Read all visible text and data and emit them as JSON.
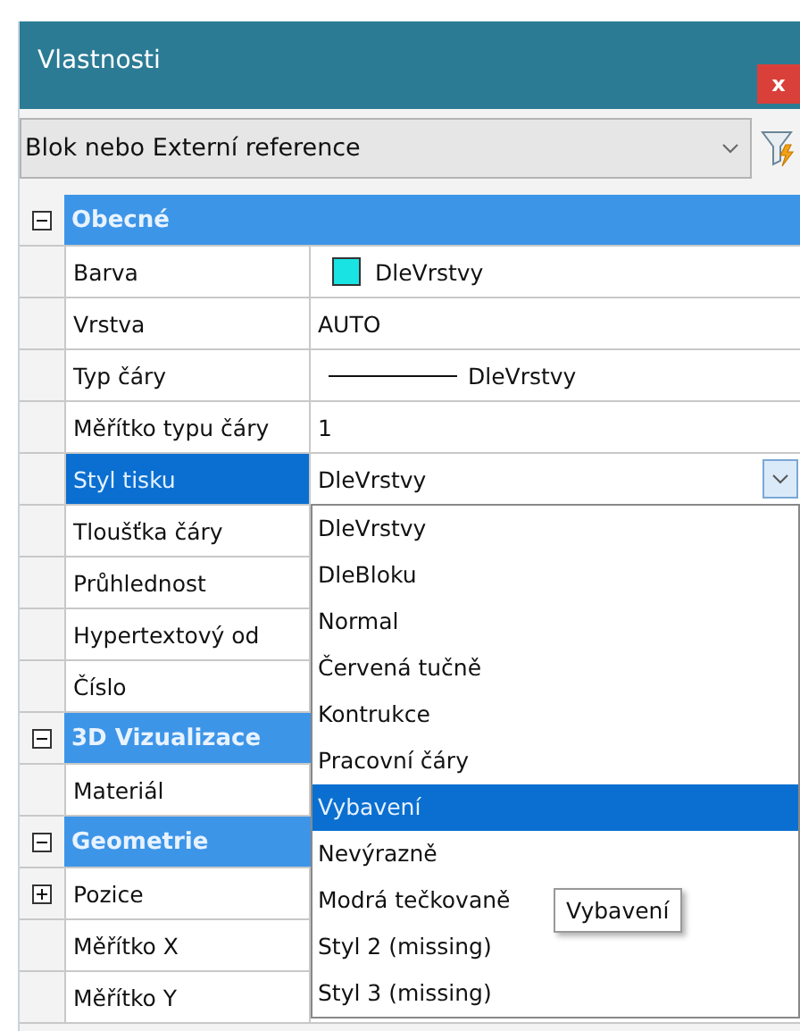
{
  "window": {
    "title": "Vlastnosti",
    "close": "x"
  },
  "selector": {
    "value": "Blok nebo Externí reference"
  },
  "sections": [
    {
      "title": "Obecné",
      "expanded": true,
      "properties": [
        {
          "name": "Barva",
          "value": "DleVrstvy",
          "kind": "color",
          "color": "#19e3e3",
          "selected": false
        },
        {
          "name": "Vrstva",
          "value": "AUTO",
          "kind": "text",
          "selected": false
        },
        {
          "name": "Typ čáry",
          "value": "DleVrstvy",
          "kind": "linetype",
          "selected": false
        },
        {
          "name": "Měřítko typu čáry",
          "value": "1",
          "kind": "text",
          "selected": false
        },
        {
          "name": "Styl tisku",
          "value": "DleVrstvy",
          "kind": "dropdown",
          "selected": true
        },
        {
          "name": "Tloušťka čáry",
          "kind": "text",
          "selected": false
        },
        {
          "name": "Průhlednost",
          "kind": "text",
          "selected": false
        },
        {
          "name": "Hypertextový od",
          "kind": "text",
          "selected": false
        },
        {
          "name": "Číslo",
          "kind": "text",
          "selected": false
        }
      ]
    },
    {
      "title": "3D Vizualizace",
      "expanded": true,
      "properties": [
        {
          "name": "Materiál",
          "kind": "text",
          "selected": false
        }
      ]
    },
    {
      "title": "Geometrie",
      "expanded": true,
      "properties": [
        {
          "name": "Pozice",
          "kind": "group",
          "expanded": false,
          "selected": false
        },
        {
          "name": "Měřítko X",
          "kind": "text",
          "selected": false
        },
        {
          "name": "Měřítko Y",
          "kind": "text",
          "selected": false
        }
      ]
    }
  ],
  "dropdown": {
    "items": [
      {
        "label": "DleVrstvy",
        "selected": false
      },
      {
        "label": "DleBloku",
        "selected": false
      },
      {
        "label": "Normal",
        "selected": false
      },
      {
        "label": "Červená tučně",
        "selected": false
      },
      {
        "label": "Kontrukce",
        "selected": false
      },
      {
        "label": "Pracovní čáry",
        "selected": false
      },
      {
        "label": "Vybavení",
        "selected": true
      },
      {
        "label": "Nevýrazně",
        "selected": false
      },
      {
        "label": "Modrá tečkovaně",
        "selected": false
      },
      {
        "label": "Styl 2 (missing)",
        "selected": false
      },
      {
        "label": "Styl 3 (missing)",
        "selected": false
      }
    ]
  },
  "tooltip": "Vybavení"
}
